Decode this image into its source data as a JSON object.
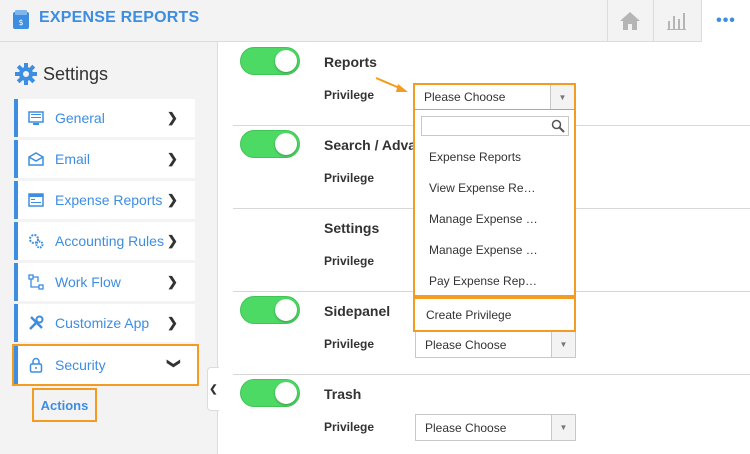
{
  "header": {
    "app_title": "EXPENSE REPORTS",
    "home_icon": "home-icon",
    "chart_icon": "bar-chart-icon",
    "more_label": "•••",
    "accent": "#3d8de0"
  },
  "sidebar": {
    "title": "Settings",
    "items": [
      {
        "label": "General",
        "icon": "monitor-icon"
      },
      {
        "label": "Email",
        "icon": "envelope-icon"
      },
      {
        "label": "Expense Reports",
        "icon": "report-icon"
      },
      {
        "label": "Accounting Rules",
        "icon": "gears-icon"
      },
      {
        "label": "Work Flow",
        "icon": "workflow-icon"
      },
      {
        "label": "Customize App",
        "icon": "tools-icon"
      },
      {
        "label": "Security",
        "icon": "lock-icon"
      }
    ],
    "sub_item": "Actions"
  },
  "main": {
    "privilege_label": "Privilege",
    "rows": [
      {
        "title": "Reports",
        "toggle": true,
        "select": "Please Choose"
      },
      {
        "title": "Search / Adva",
        "toggle": true,
        "select": ""
      },
      {
        "title": "Settings",
        "toggle": false,
        "select": ""
      },
      {
        "title": "Sidepanel",
        "toggle": true,
        "select": "Please Choose"
      },
      {
        "title": "Trash",
        "toggle": true,
        "select": "Please Choose"
      }
    ],
    "dropdown": {
      "selected": "Please Choose",
      "search_value": "",
      "options": [
        "Expense Reports",
        "View Expense Re…",
        "Manage Expense …",
        "Manage Expense …",
        "Pay Expense Rep…"
      ],
      "create_label": "Create Privilege"
    }
  },
  "colors": {
    "highlight": "#f39c1f",
    "toggle_on": "#4cd964"
  }
}
